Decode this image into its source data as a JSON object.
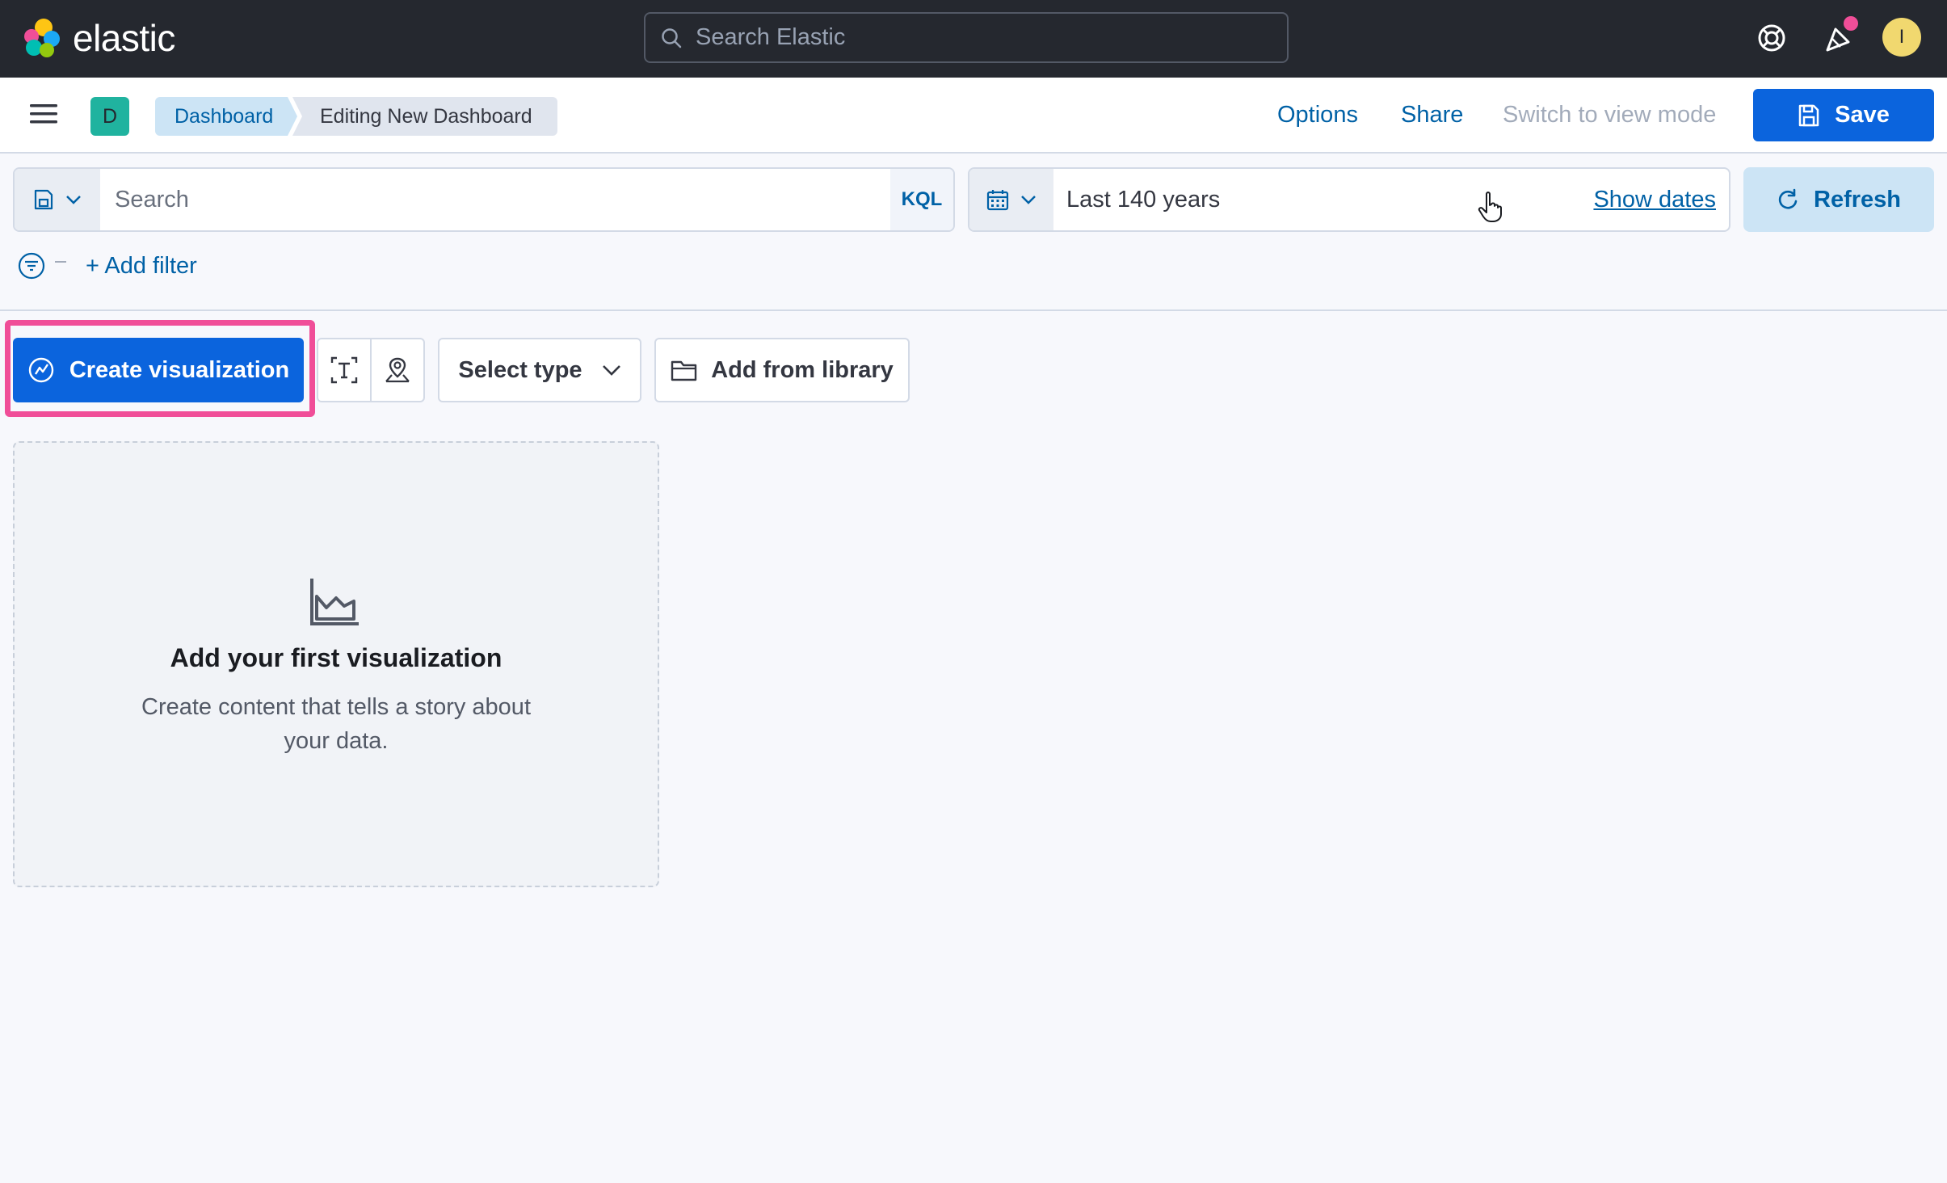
{
  "header": {
    "brand": "elastic",
    "search_placeholder": "Search Elastic",
    "avatar_initial": "I"
  },
  "appbar": {
    "space_initial": "D",
    "breadcrumbs": [
      "Dashboard",
      "Editing New Dashboard"
    ],
    "options_label": "Options",
    "share_label": "Share",
    "view_mode_label": "Switch to view mode",
    "save_label": "Save"
  },
  "query": {
    "search_placeholder": "Search",
    "language_label": "KQL",
    "date_range": "Last 140 years",
    "show_dates_label": "Show dates",
    "refresh_label": "Refresh",
    "add_filter_label": "+ Add filter"
  },
  "toolbar": {
    "create_label": "Create visualization",
    "select_type_label": "Select type",
    "add_library_label": "Add from library"
  },
  "empty_state": {
    "title": "Add your first visualization",
    "text": "Create content that tells a story about your data."
  },
  "colors": {
    "header_bg": "#25282f",
    "primary": "#0b64dd",
    "link": "#0061a6",
    "highlight": "#f04e98"
  }
}
